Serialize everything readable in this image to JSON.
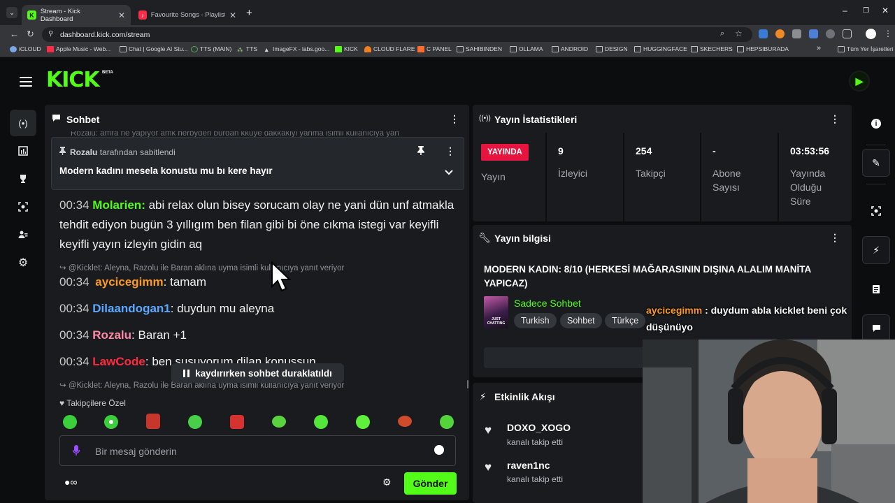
{
  "browser": {
    "tabs": [
      {
        "title": "Stream - Kick Dashboard",
        "active": true
      },
      {
        "title": "Favourite Songs - Playlist - App",
        "active": false
      }
    ],
    "url": "dashboard.kick.com/stream",
    "bookmarks": [
      "iCLOUD",
      "Apple Music - Web...",
      "Chat | Google AI Stu...",
      "TTS (MAIN)",
      "TTS",
      "ImageFX - labs.goo...",
      "KICK",
      "CLOUD FLARE",
      "C PANEL",
      "SAHIBINDEN",
      "OLLAMA",
      "ANDROID",
      "DESIGN",
      "HUGGINGFACE",
      "SKECHERS",
      "HEPSIBURADA"
    ],
    "all_bookmarks": "Tüm Yer İşaretleri",
    "more": "»"
  },
  "kick": {
    "logo": "KICK",
    "beta": "BETA"
  },
  "chat": {
    "title": "Sohbet",
    "partial_line": "Rozalu: amra ne yapıyor amk herbyden burdan kkuye dakkaklyi yanma isimli kullanıcıya yan",
    "pinned": {
      "user": "Rozalu",
      "by_suffix": "tarafından sabitlendi",
      "message": "Modern kadını mesela konustu mu bı kere hayır"
    },
    "messages": [
      {
        "time": "00:34",
        "user": "Molarien",
        "color": "#53fc18",
        "text": "abi relax olun bisey sorucam olay ne yani dün unf atmakla tehdit ediyon bugün 3 yıllıgım ben filan gibi bi öne cıkma istegi var keyifli keyifli yayın izleyin gidin aq"
      },
      {
        "time": "00:34",
        "user": "aycicegimm",
        "color": "#ff9a1f",
        "text": "tamam"
      },
      {
        "time": "00:34",
        "user": "Dilaandogan1",
        "color": "#5aa9ff",
        "text": "duydun mu aleyna"
      },
      {
        "time": "00:34",
        "user": "Rozalu",
        "color": "#ff8aa8",
        "text": "Baran +1"
      },
      {
        "time": "00:34",
        "user": "LawCode",
        "color": "#ff2a3d",
        "text": "ben susuyorum dilan konussun"
      }
    ],
    "reply_1": "@Kicklet: Aleyna, Razolu ile Baran aklına uyma isimli kullanıcıya yanıt veriyor",
    "reply_2": "@Kicklet: Aleyna, Razolu ile Baran aklına uyma isimli kullanıcıya yanıt veriyor",
    "paused": "kaydırırken sohbet duraklatıldı",
    "followers_only": "Takipçilere Özel",
    "placeholder": "Bir mesaj gönderin",
    "send": "Gönder"
  },
  "stats": {
    "title": "Yayın İstatistikleri",
    "live_badge": "YAYINDA",
    "live_label": "Yayın",
    "items": [
      {
        "value": "9",
        "label": "İzleyici"
      },
      {
        "value": "254",
        "label": "Takipçi"
      },
      {
        "value": "-",
        "label": "Abone Sayısı"
      },
      {
        "value": "03:53:56",
        "label": "Yayında Olduğu Süre"
      }
    ]
  },
  "info": {
    "title": "Yayın bilgisi",
    "stream_title": "MODERN KADIN: 8/10 (HERKESİ MAĞARASININ DIŞINA ALALIM MANİTA YAPICAZ)",
    "category": "Sadece Sohbet",
    "thumb_text": "JUST CHATTING",
    "tags": [
      "Turkish",
      "Sohbet",
      "Türkçe"
    ]
  },
  "events": {
    "title": "Etkinlik Akışı",
    "items": [
      {
        "user": "DOXO_XOGO",
        "action": "kanalı takip etti"
      },
      {
        "user": "raven1nc",
        "action": "kanalı takip etti"
      }
    ]
  },
  "overlay": {
    "user": "aycicegimm",
    "text": ": duydum abla kicklet beni çok düşünüyo"
  }
}
